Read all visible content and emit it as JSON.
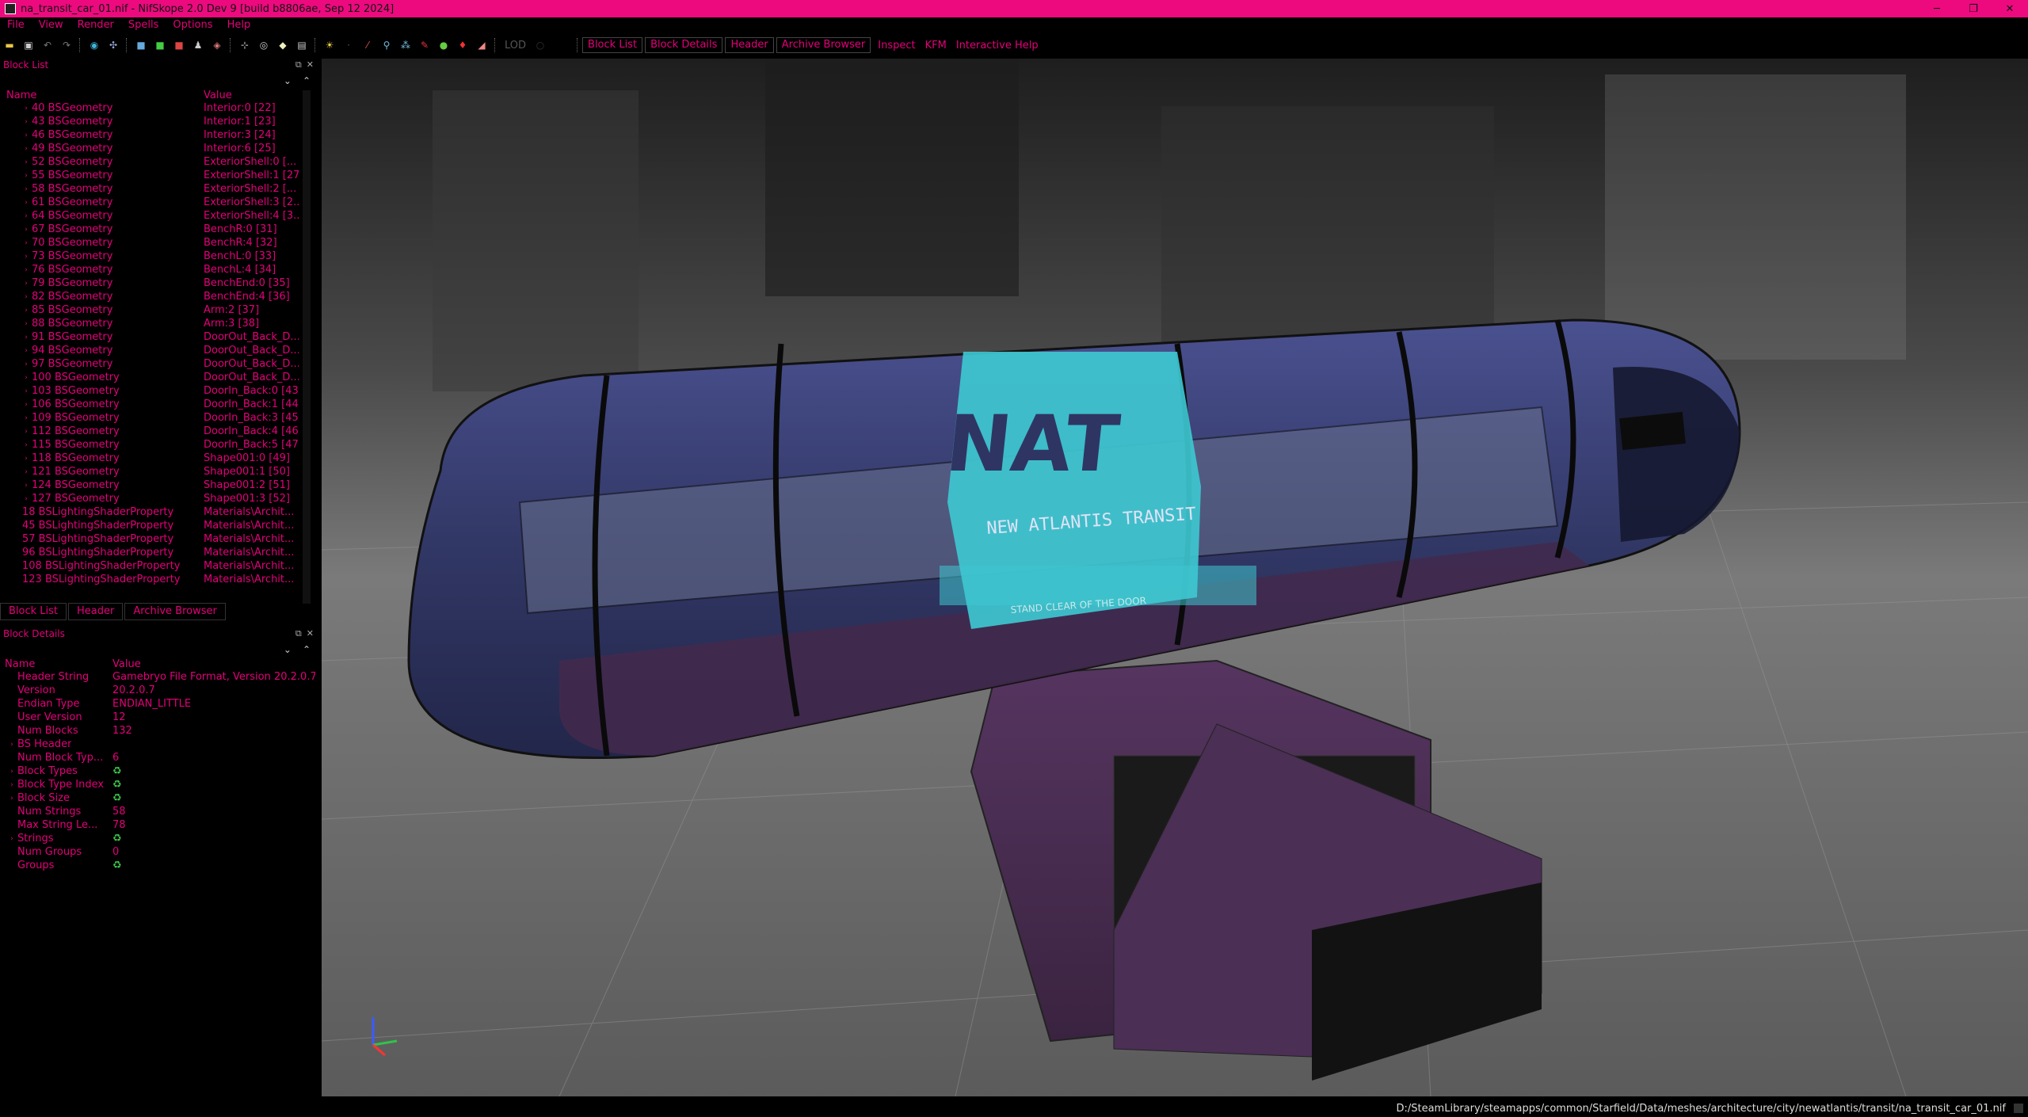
{
  "window": {
    "title": "na_transit_car_01.nif - NifSkope 2.0 Dev 9 [build b8806ae, Sep 12 2024]",
    "controls": [
      "─",
      "❐",
      "✕"
    ]
  },
  "menu": [
    "File",
    "View",
    "Render",
    "Spells",
    "Options",
    "Help"
  ],
  "toolbar": {
    "lod_label": "LOD",
    "tabs": [
      "Block List",
      "Block Details",
      "Header",
      "Archive Browser"
    ],
    "links": [
      "Inspect",
      "KFM",
      "Interactive Help"
    ]
  },
  "block_list": {
    "title": "Block List",
    "col_name": "Name",
    "col_value": "Value",
    "rows": [
      {
        "name": "40 BSGeometry",
        "value": "Interior:0 [22]"
      },
      {
        "name": "43 BSGeometry",
        "value": "Interior:1 [23]"
      },
      {
        "name": "46 BSGeometry",
        "value": "Interior:3 [24]"
      },
      {
        "name": "49 BSGeometry",
        "value": "Interior:6 [25]"
      },
      {
        "name": "52 BSGeometry",
        "value": "ExteriorShell:0 [..."
      },
      {
        "name": "55 BSGeometry",
        "value": "ExteriorShell:1 [27]"
      },
      {
        "name": "58 BSGeometry",
        "value": "ExteriorShell:2 [..."
      },
      {
        "name": "61 BSGeometry",
        "value": "ExteriorShell:3 [2..."
      },
      {
        "name": "64 BSGeometry",
        "value": "ExteriorShell:4 [3..."
      },
      {
        "name": "67 BSGeometry",
        "value": "BenchR:0 [31]"
      },
      {
        "name": "70 BSGeometry",
        "value": "BenchR:4 [32]"
      },
      {
        "name": "73 BSGeometry",
        "value": "BenchL:0 [33]"
      },
      {
        "name": "76 BSGeometry",
        "value": "BenchL:4 [34]"
      },
      {
        "name": "79 BSGeometry",
        "value": "BenchEnd:0 [35]"
      },
      {
        "name": "82 BSGeometry",
        "value": "BenchEnd:4 [36]"
      },
      {
        "name": "85 BSGeometry",
        "value": "Arm:2 [37]"
      },
      {
        "name": "88 BSGeometry",
        "value": "Arm:3 [38]"
      },
      {
        "name": "91 BSGeometry",
        "value": "DoorOut_Back_D..."
      },
      {
        "name": "94 BSGeometry",
        "value": "DoorOut_Back_D..."
      },
      {
        "name": "97 BSGeometry",
        "value": "DoorOut_Back_D..."
      },
      {
        "name": "100 BSGeometry",
        "value": "DoorOut_Back_D..."
      },
      {
        "name": "103 BSGeometry",
        "value": "DoorIn_Back:0 [43]"
      },
      {
        "name": "106 BSGeometry",
        "value": "DoorIn_Back:1 [44]"
      },
      {
        "name": "109 BSGeometry",
        "value": "DoorIn_Back:3 [45]"
      },
      {
        "name": "112 BSGeometry",
        "value": "DoorIn_Back:4 [46]"
      },
      {
        "name": "115 BSGeometry",
        "value": "DoorIn_Back:5 [47]"
      },
      {
        "name": "118 BSGeometry",
        "value": "Shape001:0 [49]"
      },
      {
        "name": "121 BSGeometry",
        "value": "Shape001:1 [50]"
      },
      {
        "name": "124 BSGeometry",
        "value": "Shape001:2 [51]"
      },
      {
        "name": "127 BSGeometry",
        "value": "Shape001:3 [52]"
      },
      {
        "name": "18 BSLightingShaderProperty",
        "value": "Materials\\Archit..."
      },
      {
        "name": "45 BSLightingShaderProperty",
        "value": "Materials\\Archit..."
      },
      {
        "name": "57 BSLightingShaderProperty",
        "value": "Materials\\Archit..."
      },
      {
        "name": "96 BSLightingShaderProperty",
        "value": "Materials\\Archit..."
      },
      {
        "name": "108 BSLightingShaderProperty",
        "value": "Materials\\Archit..."
      },
      {
        "name": "123 BSLightingShaderProperty",
        "value": "Materials\\Archit..."
      }
    ],
    "bottom_tabs": [
      "Block List",
      "Header",
      "Archive Browser"
    ]
  },
  "block_details": {
    "title": "Block Details",
    "col_name": "Name",
    "col_value": "Value",
    "rows": [
      {
        "name": "Header String",
        "value": "Gamebryo File Format, Version 20.2.0.7",
        "expand": false
      },
      {
        "name": "Version",
        "value": "20.2.0.7",
        "expand": false
      },
      {
        "name": "Endian Type",
        "value": "ENDIAN_LITTLE",
        "expand": false
      },
      {
        "name": "User Version",
        "value": "12",
        "expand": false
      },
      {
        "name": "Num Blocks",
        "value": "132",
        "expand": false
      },
      {
        "name": "BS Header",
        "value": "",
        "expand": true
      },
      {
        "name": "Num Block Typ...",
        "value": "6",
        "expand": false
      },
      {
        "name": "Block Types",
        "value": "♻",
        "expand": true
      },
      {
        "name": "Block Type Index",
        "value": "♻",
        "expand": true
      },
      {
        "name": "Block Size",
        "value": "♻",
        "expand": true
      },
      {
        "name": "Num Strings",
        "value": "58",
        "expand": false
      },
      {
        "name": "Max String Le...",
        "value": "78",
        "expand": false
      },
      {
        "name": "Strings",
        "value": "♻",
        "expand": true
      },
      {
        "name": "Num Groups",
        "value": "0",
        "expand": false
      },
      {
        "name": "Groups",
        "value": "♻",
        "expand": false
      }
    ]
  },
  "viewport": {
    "decal_big": "NAT",
    "decal_line": "NEW ATLANTIS TRANSIT",
    "decal_small": "STAND CLEAR OF THE DOOR",
    "colors": {
      "body": "#2f3563",
      "lower": "#4a2d52",
      "cyan": "#3ec7d0"
    }
  },
  "status": {
    "path": "D:/SteamLibrary/steamapps/common/Starfield/Data/meshes/architecture/city/newatlantis/transit/na_transit_car_01.nif"
  }
}
